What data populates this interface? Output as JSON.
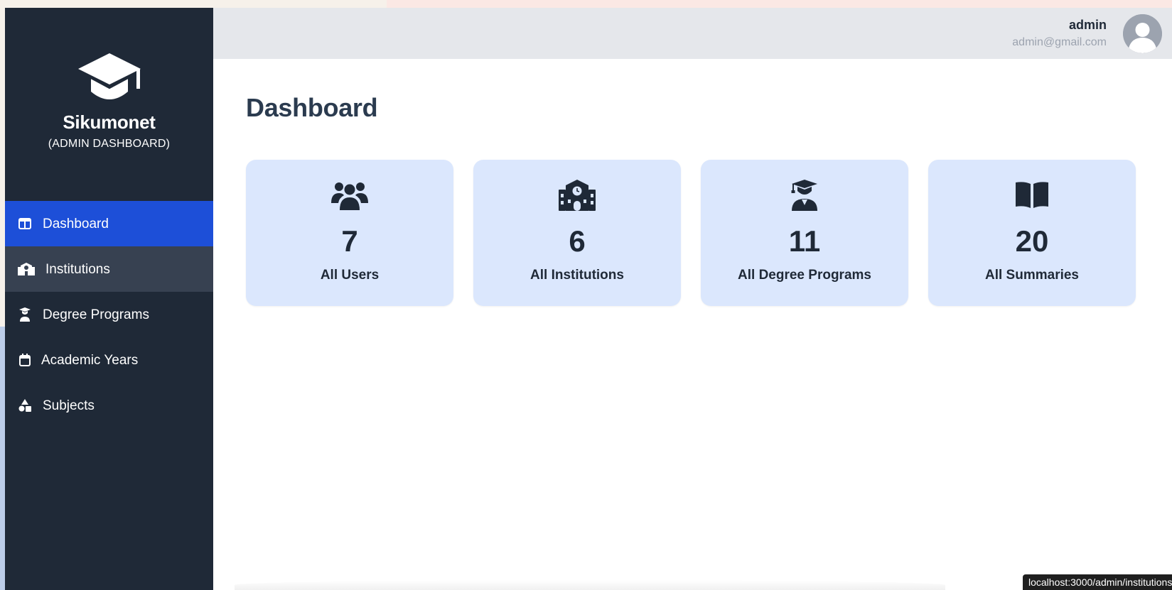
{
  "brand": {
    "name": "Sikumonet",
    "subtitle": "(ADMIN DASHBOARD)"
  },
  "sidebar": {
    "items": [
      {
        "label": "Dashboard",
        "icon": "layout-icon",
        "state": "active"
      },
      {
        "label": "Institutions",
        "icon": "school-icon",
        "state": "hover"
      },
      {
        "label": "Degree Programs",
        "icon": "graduate-icon",
        "state": "normal"
      },
      {
        "label": "Academic Years",
        "icon": "calendar-icon",
        "state": "normal"
      },
      {
        "label": "Subjects",
        "icon": "shapes-icon",
        "state": "normal"
      }
    ]
  },
  "header": {
    "user_name": "admin",
    "user_email": "admin@gmail.com"
  },
  "main": {
    "title": "Dashboard",
    "cards": [
      {
        "value": "7",
        "label": "All Users",
        "icon": "users-icon"
      },
      {
        "value": "6",
        "label": "All Institutions",
        "icon": "school-icon"
      },
      {
        "value": "11",
        "label": "All Degree Programs",
        "icon": "graduate-icon"
      },
      {
        "value": "20",
        "label": "All Summaries",
        "icon": "book-open-icon"
      }
    ]
  },
  "status_bar": {
    "url": "localhost:3000/admin/institutions"
  },
  "colors": {
    "sidebar_bg": "#1f2937",
    "active_item": "#1d4fd8",
    "card_bg": "#dbe7fd",
    "topbar_bg": "#e5e7eb"
  }
}
